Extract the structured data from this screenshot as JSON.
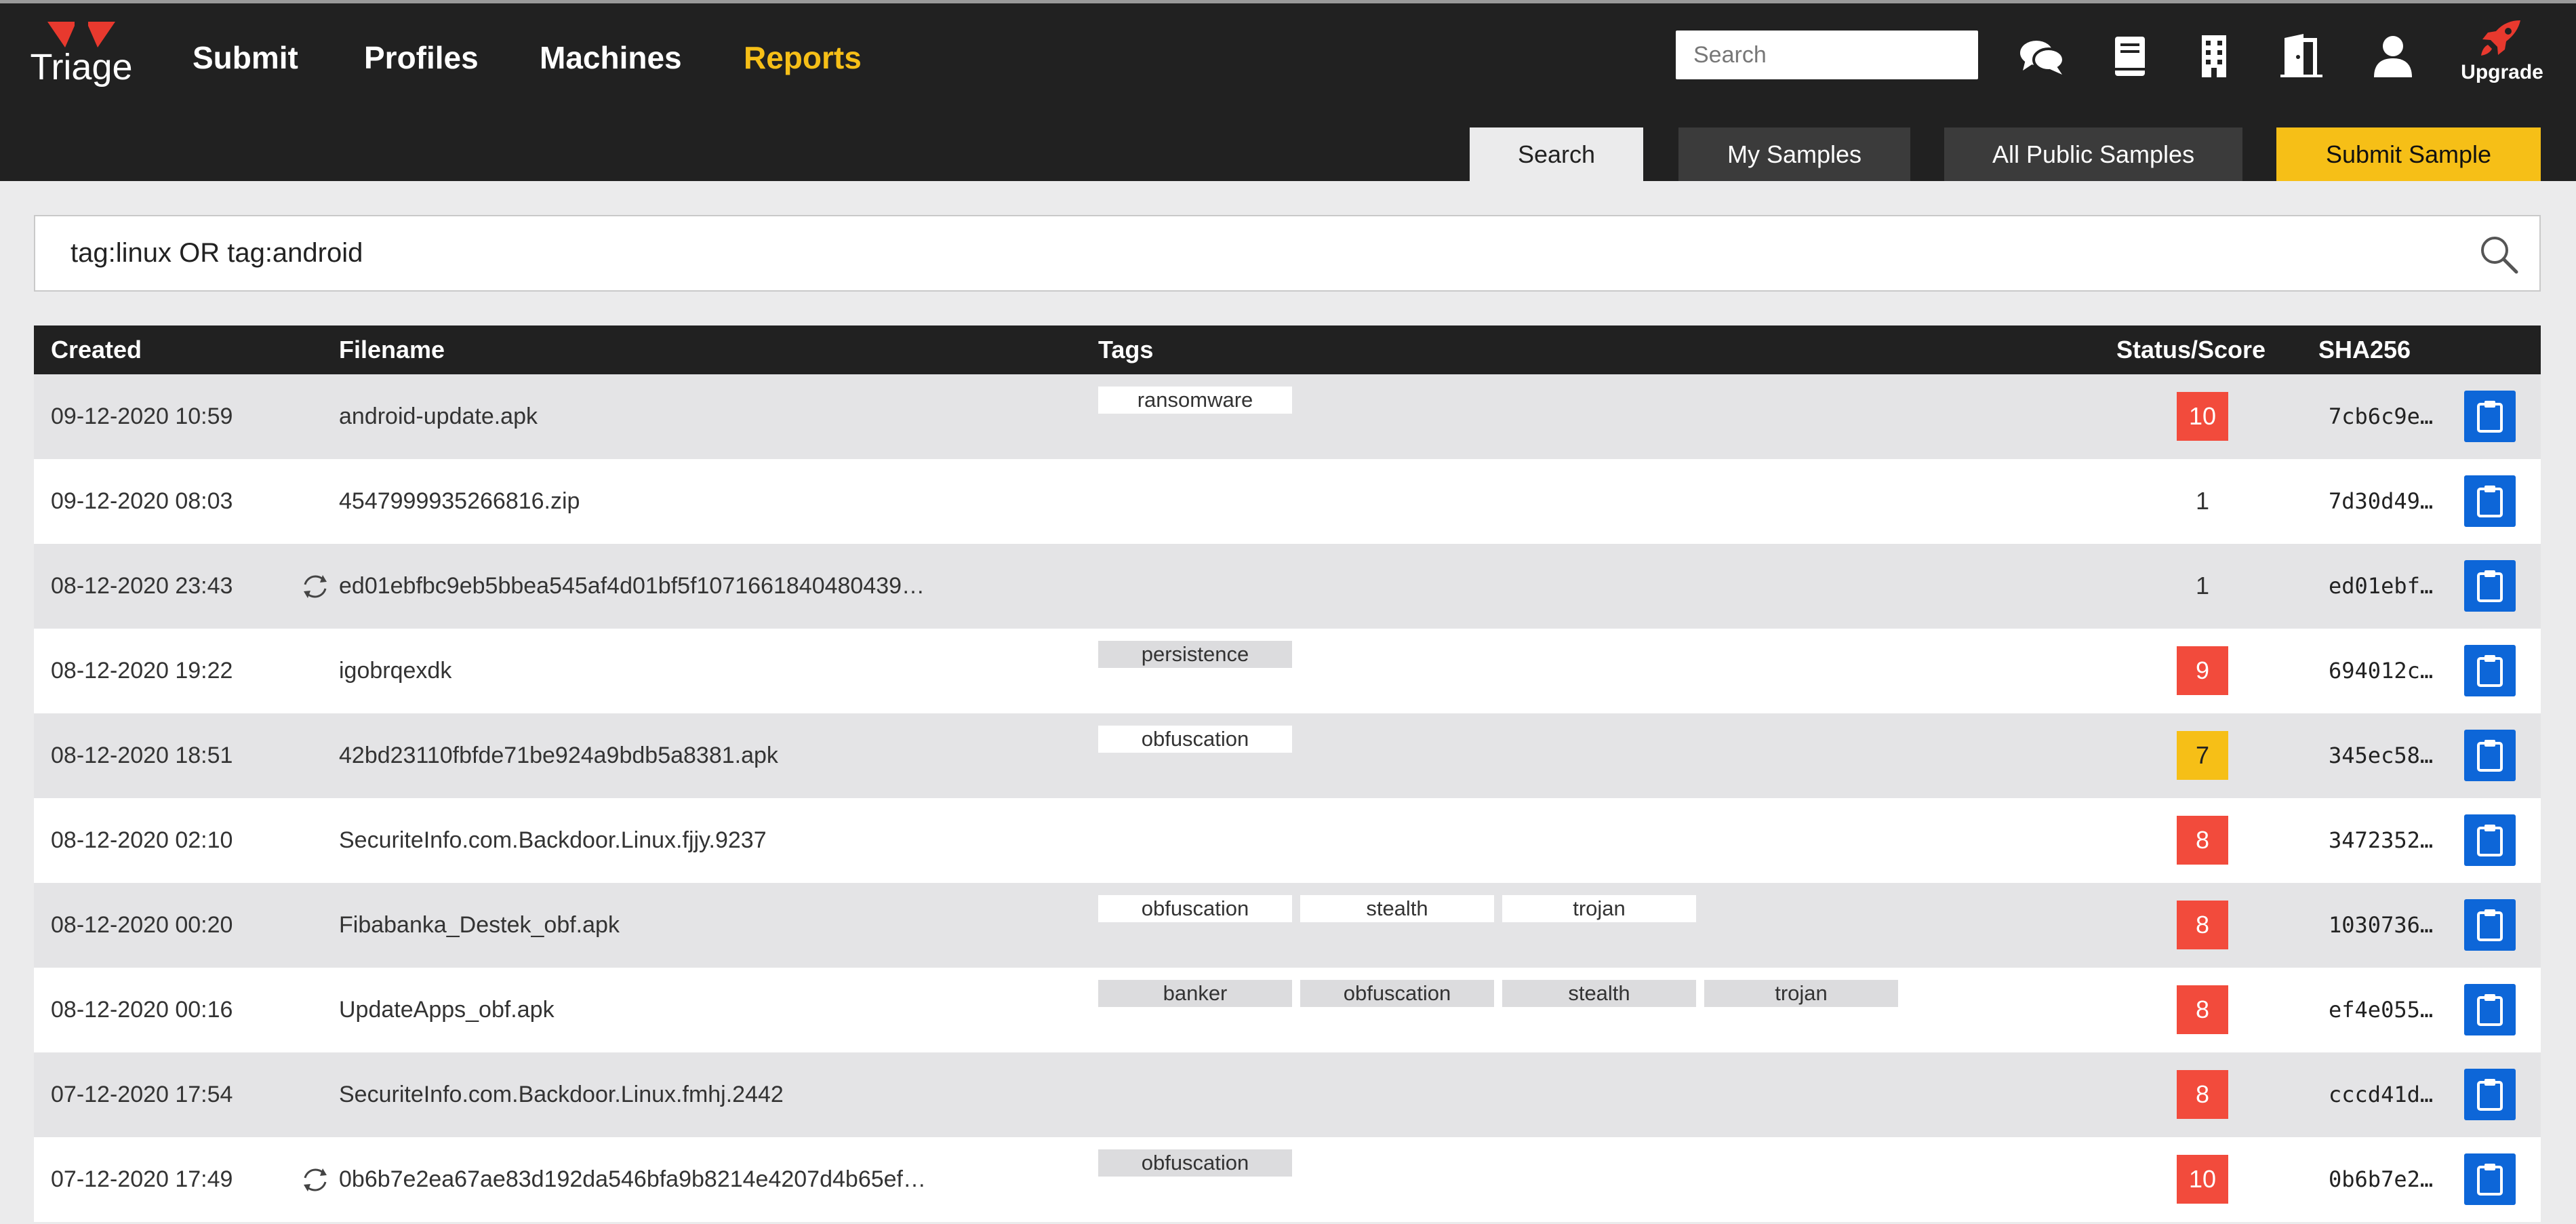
{
  "header": {
    "logo_text": "Triage",
    "nav": [
      {
        "label": "Submit",
        "active": false
      },
      {
        "label": "Profiles",
        "active": false
      },
      {
        "label": "Machines",
        "active": false
      },
      {
        "label": "Reports",
        "active": true
      }
    ],
    "search_placeholder": "Search",
    "icons": [
      "chat-icon",
      "book-icon",
      "building-icon",
      "door-exit-icon",
      "user-icon",
      "rocket-icon"
    ],
    "upgrade_label": "Upgrade"
  },
  "tabs": [
    {
      "label": "Search",
      "state": "selected"
    },
    {
      "label": "My Samples",
      "state": "dark"
    },
    {
      "label": "All Public Samples",
      "state": "dark"
    },
    {
      "label": "Submit Sample",
      "state": "submit"
    }
  ],
  "query": {
    "value": "tag:linux OR tag:android"
  },
  "table": {
    "columns": {
      "created": "Created",
      "filename": "Filename",
      "tags": "Tags",
      "status": "Status/Score",
      "sha": "SHA256"
    },
    "rows": [
      {
        "created": "09-12-2020 10:59",
        "filename": "android-update.apk",
        "reload": false,
        "tags": [
          "ransomware"
        ],
        "score": "10",
        "score_color": "red",
        "sha": "7cb6c9e…"
      },
      {
        "created": "09-12-2020 08:03",
        "filename": "4547999935266816.zip",
        "reload": false,
        "tags": [],
        "score": "1",
        "score_color": "plain",
        "sha": "7d30d49…"
      },
      {
        "created": "08-12-2020 23:43",
        "filename": "ed01ebfbc9eb5bbea545af4d01bf5f1071661840480439…",
        "reload": true,
        "tags": [],
        "score": "1",
        "score_color": "plain",
        "sha": "ed01ebf…"
      },
      {
        "created": "08-12-2020 19:22",
        "filename": "igobrqexdk",
        "reload": false,
        "tags": [
          "persistence"
        ],
        "score": "9",
        "score_color": "red",
        "sha": "694012c…"
      },
      {
        "created": "08-12-2020 18:51",
        "filename": "42bd23110fbfde71be924a9bdb5a8381.apk",
        "reload": false,
        "tags": [
          "obfuscation"
        ],
        "score": "7",
        "score_color": "yellow",
        "sha": "345ec58…"
      },
      {
        "created": "08-12-2020 02:10",
        "filename": "SecuriteInfo.com.Backdoor.Linux.fjjy.9237",
        "reload": false,
        "tags": [],
        "score": "8",
        "score_color": "red",
        "sha": "3472352…"
      },
      {
        "created": "08-12-2020 00:20",
        "filename": "Fibabanka_Destek_obf.apk",
        "reload": false,
        "tags": [
          "obfuscation",
          "stealth",
          "trojan"
        ],
        "score": "8",
        "score_color": "red",
        "sha": "1030736…"
      },
      {
        "created": "08-12-2020 00:16",
        "filename": "UpdateApps_obf.apk",
        "reload": false,
        "tags": [
          "banker",
          "obfuscation",
          "stealth",
          "trojan"
        ],
        "score": "8",
        "score_color": "red",
        "sha": "ef4e055…"
      },
      {
        "created": "07-12-2020 17:54",
        "filename": "SecuriteInfo.com.Backdoor.Linux.fmhj.2442",
        "reload": false,
        "tags": [],
        "score": "8",
        "score_color": "red",
        "sha": "cccd41d…"
      },
      {
        "created": "07-12-2020 17:49",
        "filename": "0b6b7e2ea67ae83d192da546bfa9b8214e4207d4b65ef…",
        "reload": true,
        "tags": [
          "obfuscation"
        ],
        "score": "10",
        "score_color": "red",
        "sha": "0b6b7e2…"
      }
    ]
  }
}
